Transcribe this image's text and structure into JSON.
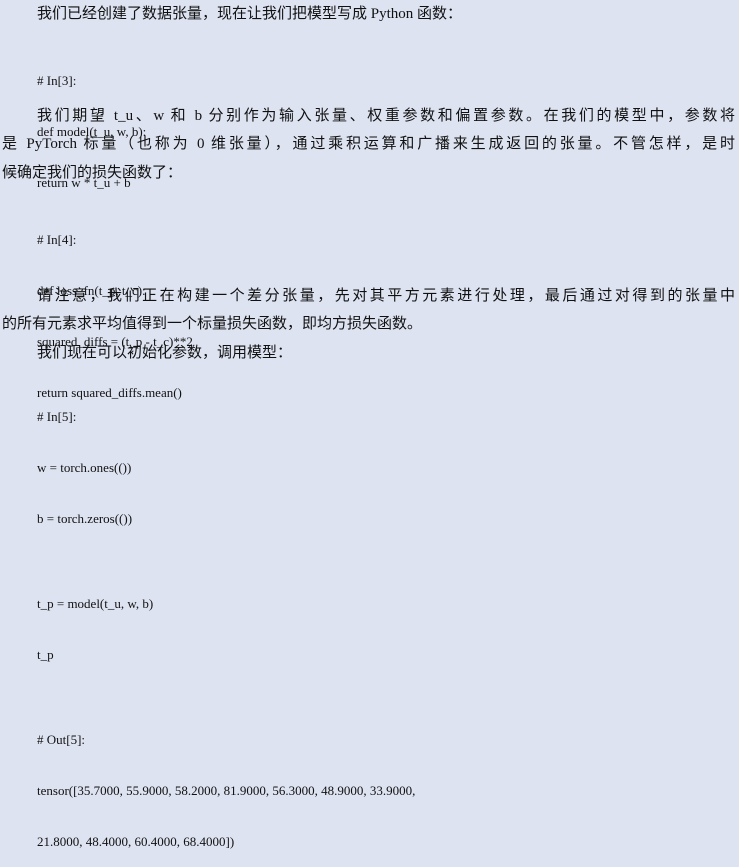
{
  "para1": "我们已经创建了数据张量，现在让我们把模型写成 Python 函数：",
  "code1": [
    "# In[3]:",
    "def model(t_u, w, b):",
    "    return w * t_u + b"
  ],
  "para2": [
    "我们期望 t_u、w 和 b 分别作为输入张量、权重参数和偏置参数。在我们的模型中，参数将",
    "是 PyTorch 标量（也称为 0 维张量），通过乘积运算和广播来生成返回的张量。不管怎样，是时",
    "候确定我们的损失函数了："
  ],
  "code2": [
    "# In[4]:",
    "def loss_fn(t_p, t_c):",
    "    squared_diffs = (t_p - t_c)**2",
    "    return squared_diffs.mean()"
  ],
  "para3": [
    "请注意，我们正在构建一个差分张量，先对其平方元素进行处理，最后通过对得到的张量中",
    "的所有元素求平均值得到一个标量损失函数，即均方损失函数。"
  ],
  "para4": "我们现在可以初始化参数，调用模型：",
  "code3": [
    "# In[5]:",
    "w = torch.ones(())",
    "b = torch.zeros(())",
    "",
    "t_p = model(t_u, w, b)",
    "t_p",
    "",
    "# Out[5]:",
    "tensor([35.7000, 55.9000, 58.2000, 81.9000, 56.3000, 48.9000, 33.9000,",
    "        21.8000, 48.4000, 60.4000, 68.4000])"
  ]
}
